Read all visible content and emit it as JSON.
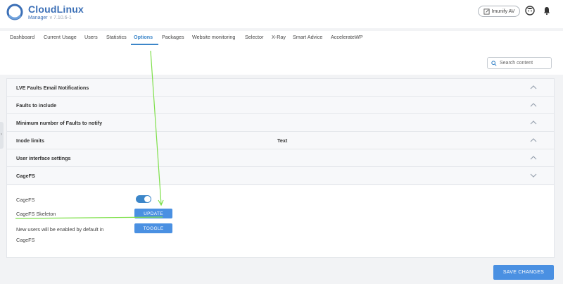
{
  "app": {
    "name": "CloudLinux",
    "subtitle": "Manager",
    "version": "v 7.10.6-1"
  },
  "header": {
    "imunify_label": "Imunify AV",
    "icons": [
      "external-edit-icon",
      "profile-icon",
      "bell-icon"
    ]
  },
  "tabs": [
    {
      "label": "Dashboard"
    },
    {
      "label": "Current Usage"
    },
    {
      "label": "Users"
    },
    {
      "label": "Statistics"
    },
    {
      "label": "Options",
      "active": true
    },
    {
      "label": "Packages"
    },
    {
      "label": "Website monitoring"
    },
    {
      "label": "Selector"
    },
    {
      "label": "X-Ray"
    },
    {
      "label": "Smart Advice"
    },
    {
      "label": "AccelerateWP"
    }
  ],
  "search": {
    "placeholder": "Search content"
  },
  "sections": [
    {
      "title": "LVE Faults Email Notifications",
      "expanded": false
    },
    {
      "title": "Faults to include",
      "expanded": false
    },
    {
      "title": "Minimum number of Faults to notify",
      "expanded": false
    },
    {
      "title": "Inode limits",
      "expanded": false
    },
    {
      "title": "User interface settings",
      "expanded": false
    },
    {
      "title": "CageFS",
      "expanded": true
    }
  ],
  "annotation": {
    "text": "Text"
  },
  "cagefs": {
    "cagefs_label": "CageFS",
    "cagefs_enabled": true,
    "skeleton_label": "CageFS Skeleton",
    "update_label": "UPDATE",
    "new_users_label_line1": "New users will be enabled by default in",
    "new_users_label_line2": "CageFS",
    "toggle_label": "TOGGLE"
  },
  "footer": {
    "save_label": "SAVE CHANGES"
  },
  "colors": {
    "accent": "#3c86c9",
    "button": "#4a90e2",
    "annotation_line": "#7ee04a"
  }
}
